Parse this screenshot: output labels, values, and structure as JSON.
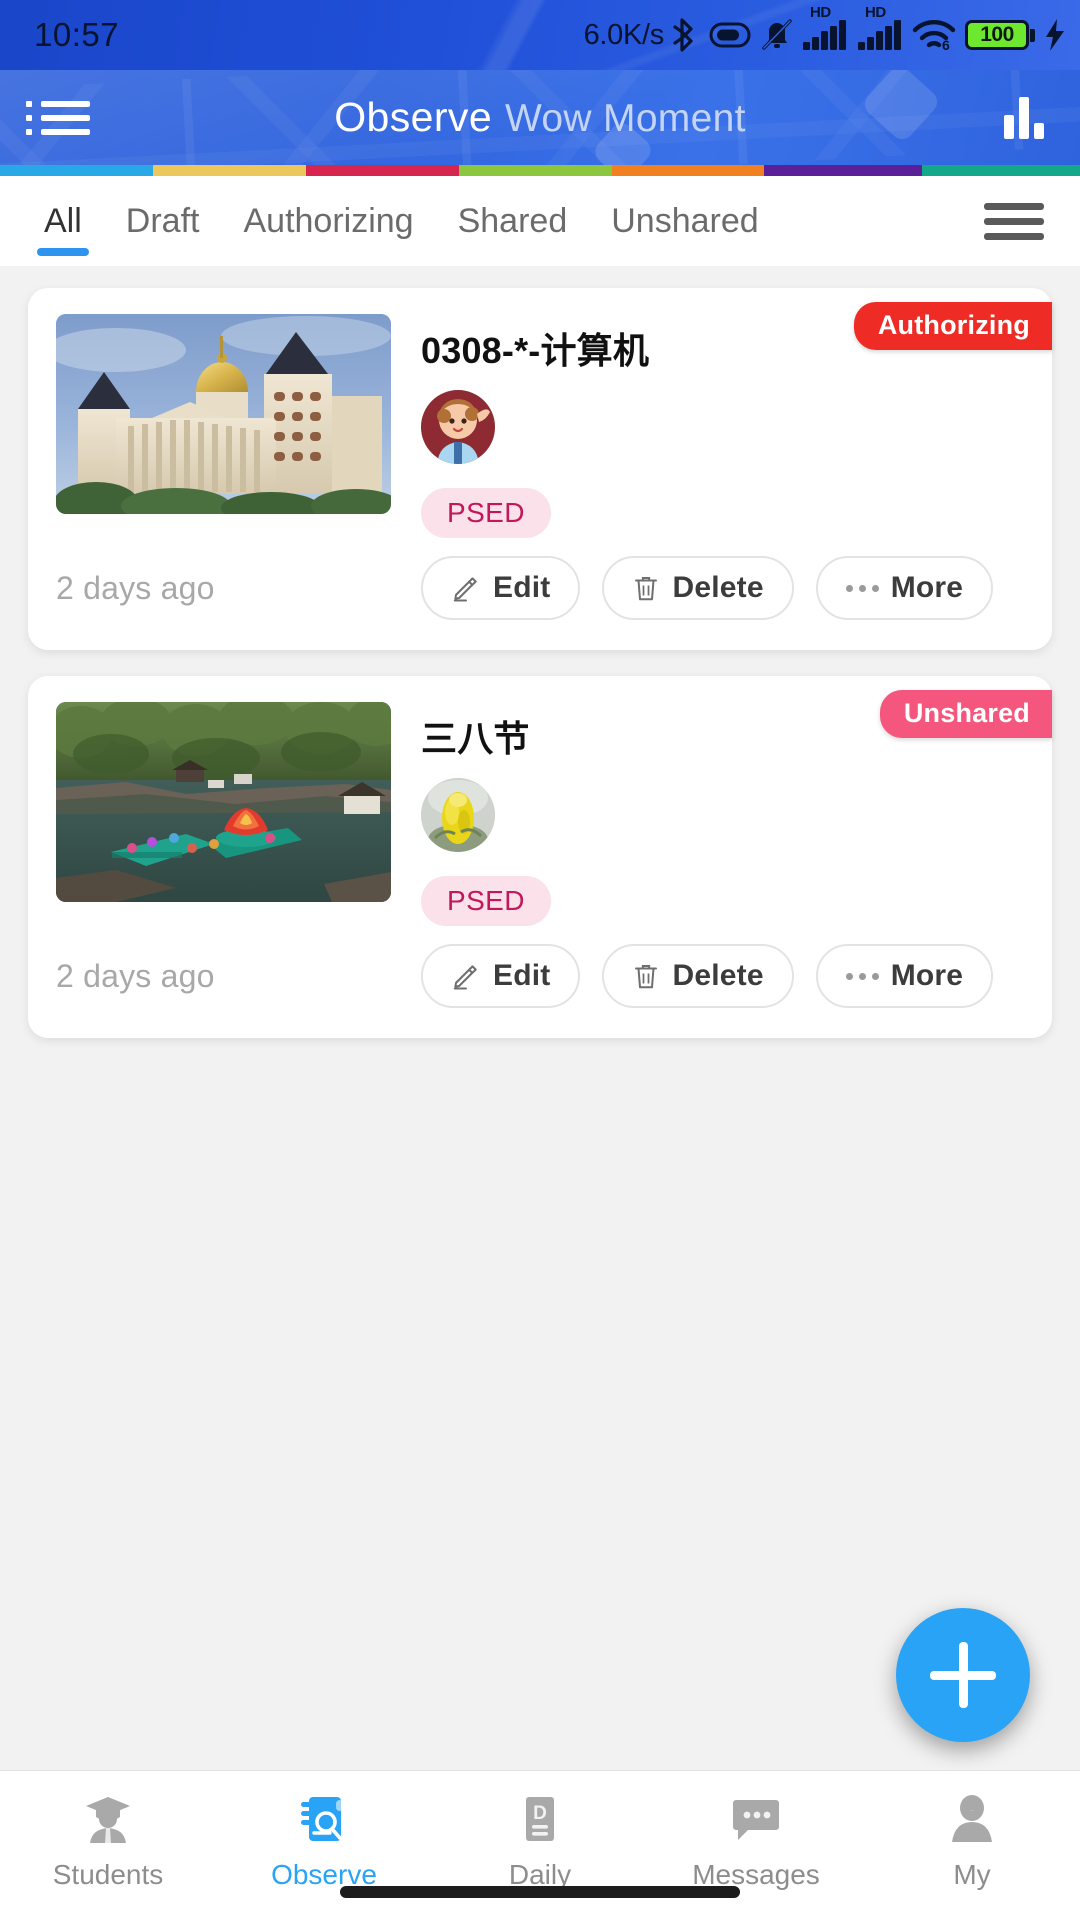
{
  "status_bar": {
    "time": "10:57",
    "network_speed": "6.0K/s",
    "battery_percent": "100",
    "icons": [
      "bluetooth-icon",
      "vpn-icon",
      "mute-bell-icon",
      "hd-signal-icon",
      "hd-signal-icon",
      "wifi6-icon",
      "battery-icon",
      "charging-bolt-icon"
    ],
    "wifi_label": "6"
  },
  "header": {
    "menu_icon": "list-menu-icon",
    "title_main": "Observe",
    "title_sub": "Wow Moment",
    "chart_icon": "bar-chart-icon",
    "strip_colors": [
      "#29a8e8",
      "#ecc85c",
      "#d6264f",
      "#8cc63e",
      "#f08020",
      "#5b1f99",
      "#14a88a"
    ]
  },
  "tabs": {
    "items": [
      {
        "label": "All",
        "active": true
      },
      {
        "label": "Draft",
        "active": false
      },
      {
        "label": "Authorizing",
        "active": false
      },
      {
        "label": "Shared",
        "active": false
      },
      {
        "label": "Unshared",
        "active": false
      }
    ],
    "menu_icon": "hamburger-icon",
    "active_color": "#2d93ee"
  },
  "cards": [
    {
      "badge": {
        "label": "Authorizing",
        "color": "#ee2b24"
      },
      "title": "0308-*-计算机",
      "thumbnail": "photo-classical-building-with-gold-dome",
      "avatar": "child-cartoon-avatar",
      "tag": "PSED",
      "timestamp": "2 days ago",
      "actions": [
        {
          "label": "Edit",
          "icon": "pencil-icon"
        },
        {
          "label": "Delete",
          "icon": "trash-icon"
        },
        {
          "label": "More",
          "icon": "ellipsis-icon"
        }
      ]
    },
    {
      "badge": {
        "label": "Unshared",
        "color": "#f5567e"
      },
      "title": "三八节",
      "thumbnail": "photo-park-lake-with-lotus-float",
      "avatar": "yellow-flower-avatar",
      "tag": "PSED",
      "timestamp": "2 days ago",
      "actions": [
        {
          "label": "Edit",
          "icon": "pencil-icon"
        },
        {
          "label": "Delete",
          "icon": "trash-icon"
        },
        {
          "label": "More",
          "icon": "ellipsis-icon"
        }
      ]
    }
  ],
  "fab": {
    "icon": "plus-icon",
    "color": "#29a3f5"
  },
  "bottom_nav": {
    "items": [
      {
        "label": "Students",
        "icon": "graduate-person-icon",
        "active": false
      },
      {
        "label": "Observe",
        "icon": "notebook-search-icon",
        "active": true
      },
      {
        "label": "Daily",
        "icon": "document-d-icon",
        "active": false
      },
      {
        "label": "Messages",
        "icon": "speech-bubble-icon",
        "active": false
      },
      {
        "label": "My",
        "icon": "person-icon",
        "active": false
      }
    ],
    "active_color": "#29a3f5"
  },
  "tag_colors": {
    "psed_bg": "#fbe1ea",
    "psed_text": "#c2185b"
  }
}
